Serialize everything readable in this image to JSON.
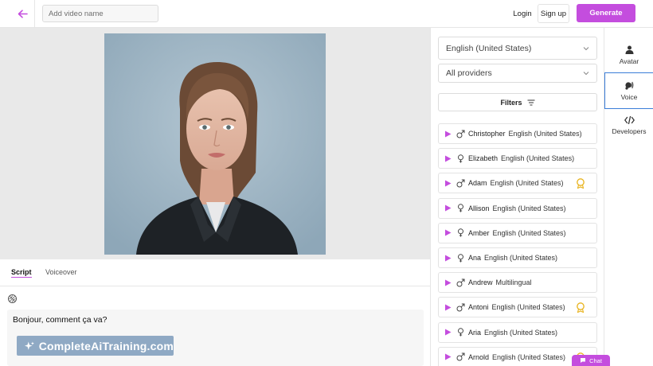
{
  "header": {
    "video_name_placeholder": "Add video name",
    "login_label": "Login",
    "signup_label": "Sign up",
    "generate_label": "Generate"
  },
  "editor": {
    "tabs": [
      {
        "label": "Script",
        "active": true
      },
      {
        "label": "Voiceover",
        "active": false
      }
    ],
    "script_text": "Bonjour, comment ça va?",
    "watermark_text": "CompleteAiTraining.com"
  },
  "voice_panel": {
    "language_select": "English (United States)",
    "provider_select": "All providers",
    "filters_label": "Filters",
    "voices": [
      {
        "name": "Christopher",
        "language": "English (United States)",
        "gender": "male",
        "badge": false
      },
      {
        "name": "Elizabeth",
        "language": "English (United States)",
        "gender": "female",
        "badge": false
      },
      {
        "name": "Adam",
        "language": "English (United States)",
        "gender": "male",
        "badge": true
      },
      {
        "name": "Allison",
        "language": "English (United States)",
        "gender": "female",
        "badge": false
      },
      {
        "name": "Amber",
        "language": "English (United States)",
        "gender": "female",
        "badge": false
      },
      {
        "name": "Ana",
        "language": "English (United States)",
        "gender": "female",
        "badge": false
      },
      {
        "name": "Andrew",
        "language": "Multilingual",
        "gender": "male",
        "badge": false
      },
      {
        "name": "Antoni",
        "language": "English (United States)",
        "gender": "male",
        "badge": true
      },
      {
        "name": "Aria",
        "language": "English (United States)",
        "gender": "female",
        "badge": false
      },
      {
        "name": "Arnold",
        "language": "English (United States)",
        "gender": "male",
        "badge": true
      }
    ]
  },
  "sidebar": {
    "items": [
      {
        "label": "Avatar",
        "icon": "person-icon",
        "active": false
      },
      {
        "label": "Voice",
        "icon": "voice-icon",
        "active": true
      },
      {
        "label": "Developers",
        "icon": "code-icon",
        "active": false
      }
    ]
  },
  "chat": {
    "label": "Chat"
  },
  "colors": {
    "accent": "#c44dde",
    "active_border": "#3b7dd8"
  }
}
